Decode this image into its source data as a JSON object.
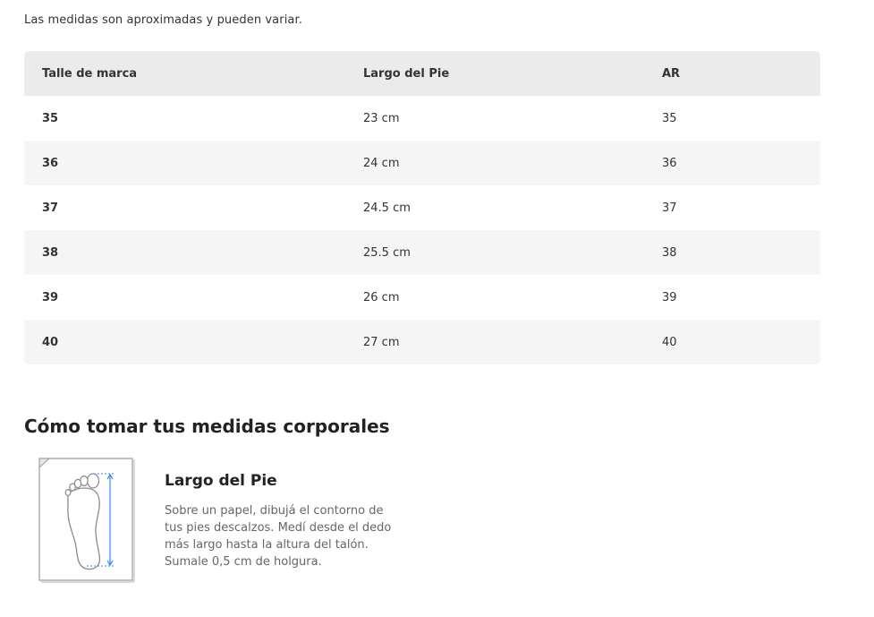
{
  "disclaimer": "Las medidas son aproximadas y pueden variar.",
  "table": {
    "headers": [
      "Talle de marca",
      "Largo del Pie",
      "AR"
    ],
    "rows": [
      [
        "35",
        "23 cm",
        "35"
      ],
      [
        "36",
        "24 cm",
        "36"
      ],
      [
        "37",
        "24.5 cm",
        "37"
      ],
      [
        "38",
        "25.5 cm",
        "38"
      ],
      [
        "39",
        "26 cm",
        "39"
      ],
      [
        "40",
        "27 cm",
        "40"
      ]
    ]
  },
  "measure_section": {
    "title": "Cómo tomar tus medidas corporales",
    "guide": {
      "icon": "foot-measure-icon",
      "title": "Largo del Pie",
      "description": "Sobre un papel, dibujá el contorno de tus pies descalzos. Medí desde el dedo más largo hasta la altura del talón. Sumale 0,5 cm de holgura."
    }
  },
  "colors": {
    "header_bg": "#ebebeb",
    "alt_row_bg": "#f5f5f5",
    "measure_line": "#3483fa"
  }
}
